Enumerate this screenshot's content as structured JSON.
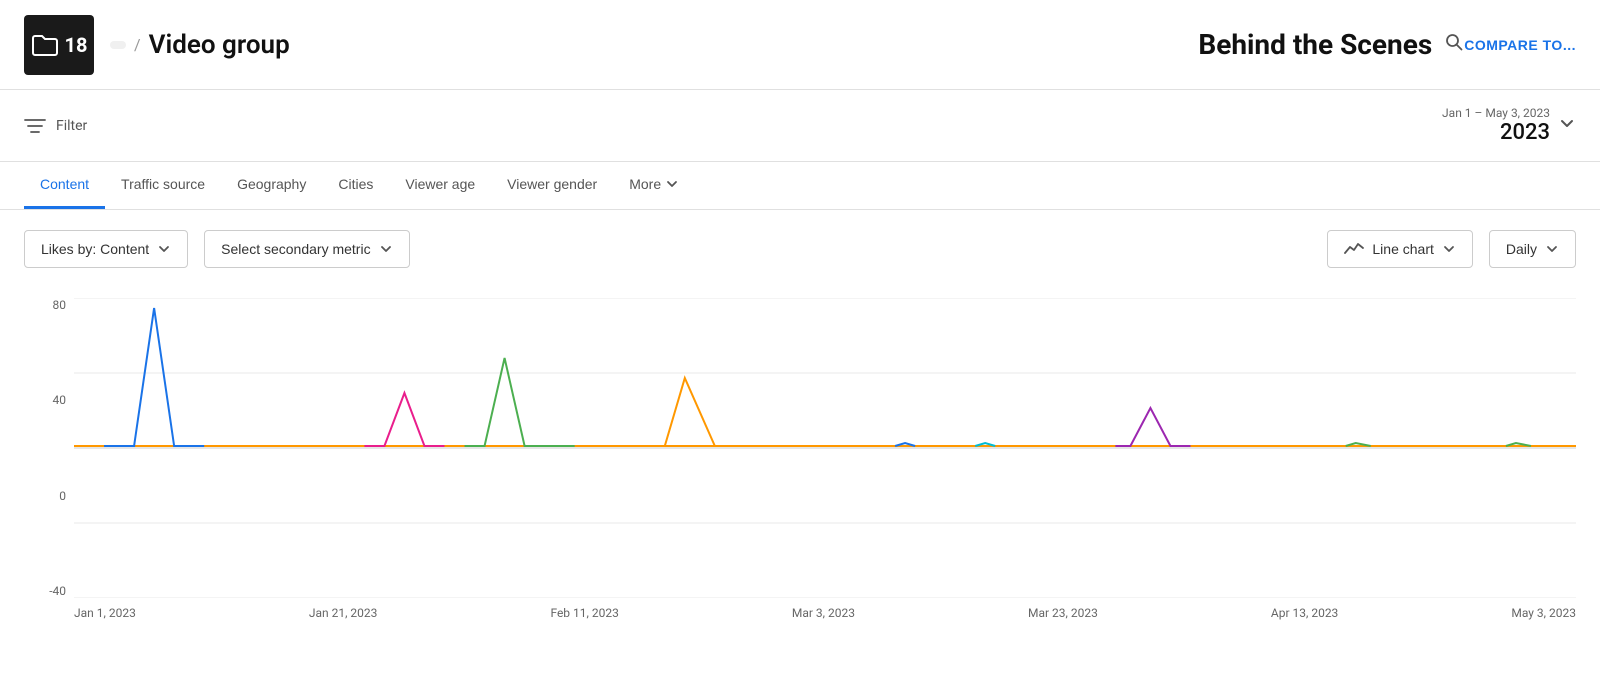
{
  "header": {
    "folder_count": "18",
    "breadcrumb_parent": "",
    "breadcrumb_sep": "/",
    "breadcrumb_video_group": "Video group",
    "title": "Behind the Scenes",
    "search_placeholder": "Search",
    "compare_label": "COMPARE TO..."
  },
  "filter_bar": {
    "filter_label": "Filter",
    "date_range": "Jan 1 – May 3, 2023",
    "date_year": "2023"
  },
  "tabs": [
    {
      "id": "content",
      "label": "Content",
      "active": true
    },
    {
      "id": "traffic-source",
      "label": "Traffic source",
      "active": false
    },
    {
      "id": "geography",
      "label": "Geography",
      "active": false
    },
    {
      "id": "cities",
      "label": "Cities",
      "active": false
    },
    {
      "id": "viewer-age",
      "label": "Viewer age",
      "active": false
    },
    {
      "id": "viewer-gender",
      "label": "Viewer gender",
      "active": false
    },
    {
      "id": "more",
      "label": "More",
      "active": false
    }
  ],
  "controls": {
    "primary_metric_label": "Likes by: Content",
    "secondary_metric_label": "Select secondary metric",
    "chart_type_label": "Line chart",
    "frequency_label": "Daily"
  },
  "chart": {
    "y_labels": [
      "80",
      "40",
      "0",
      "-40"
    ],
    "x_labels": [
      "Jan 1, 2023",
      "Jan 21, 2023",
      "Feb 11, 2023",
      "Mar 3, 2023",
      "Mar 23, 2023",
      "Apr 13, 2023",
      "May 3, 2023"
    ],
    "colors": {
      "blue": "#1a73e8",
      "pink": "#e91e8c",
      "green": "#4caf50",
      "orange": "#ff9800",
      "purple": "#9c27b0",
      "teal": "#00bcd4",
      "yellow": "#ffc107"
    }
  }
}
